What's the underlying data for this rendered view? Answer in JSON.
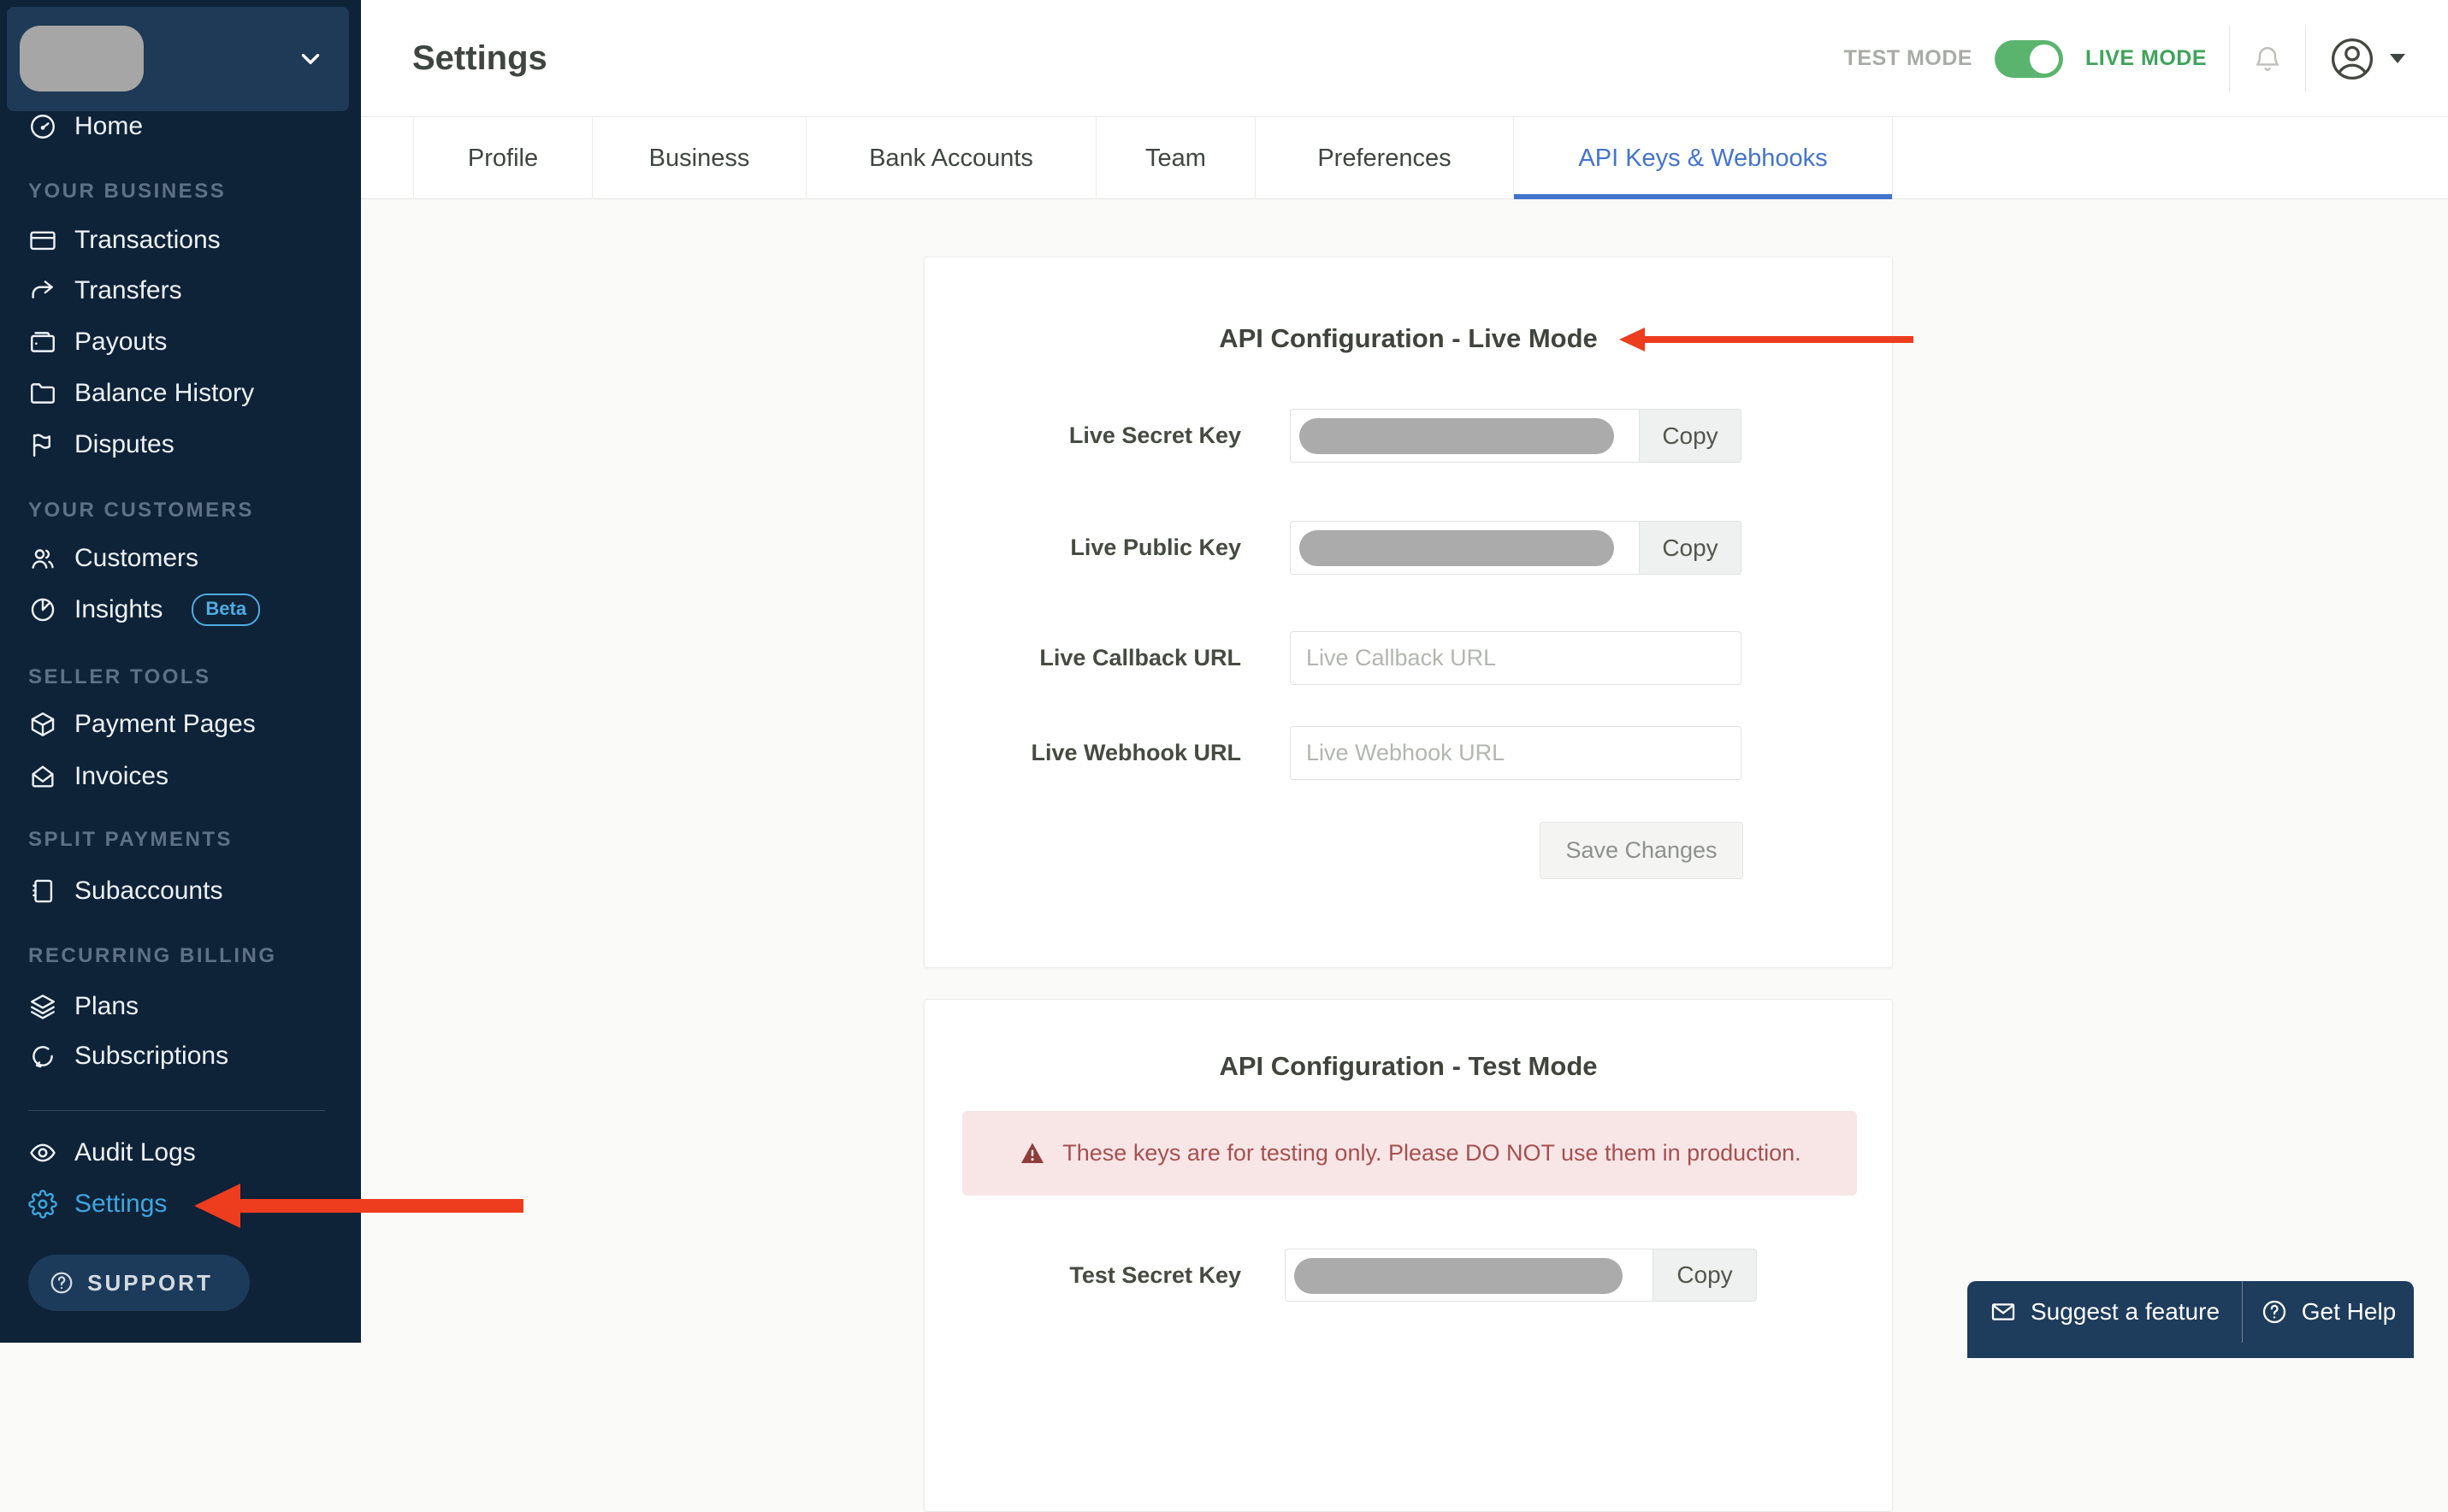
{
  "sidebar": {
    "nav": [
      {
        "label": "Home",
        "icon": "gauge-icon"
      }
    ],
    "sections": [
      {
        "title": "YOUR BUSINESS",
        "items": [
          {
            "label": "Transactions",
            "icon": "credit-card-icon"
          },
          {
            "label": "Transfers",
            "icon": "share-arrow-icon"
          },
          {
            "label": "Payouts",
            "icon": "wallet-icon"
          },
          {
            "label": "Balance History",
            "icon": "folder-icon"
          },
          {
            "label": "Disputes",
            "icon": "flag-icon"
          }
        ]
      },
      {
        "title": "YOUR CUSTOMERS",
        "items": [
          {
            "label": "Customers",
            "icon": "people-icon"
          },
          {
            "label": "Insights",
            "icon": "pie-chart-icon",
            "badge": "Beta"
          }
        ]
      },
      {
        "title": "SELLER TOOLS",
        "items": [
          {
            "label": "Payment Pages",
            "icon": "box-icon"
          },
          {
            "label": "Invoices",
            "icon": "envelope-open-icon"
          }
        ]
      },
      {
        "title": "SPLIT PAYMENTS",
        "items": [
          {
            "label": "Subaccounts",
            "icon": "notebook-icon"
          }
        ]
      },
      {
        "title": "RECURRING BILLING",
        "items": [
          {
            "label": "Plans",
            "icon": "layers-icon"
          },
          {
            "label": "Subscriptions",
            "icon": "loop-icon"
          }
        ]
      }
    ],
    "bottom_items": [
      {
        "label": "Audit Logs",
        "icon": "eye-icon",
        "active": false
      },
      {
        "label": "Settings",
        "icon": "gear-icon",
        "active": true
      }
    ],
    "support_label": "SUPPORT"
  },
  "header": {
    "title": "Settings",
    "test_mode_label": "TEST MODE",
    "live_mode_label": "LIVE MODE",
    "toggle_state": "on"
  },
  "tabs": [
    {
      "label": "Profile",
      "active": false
    },
    {
      "label": "Business",
      "active": false
    },
    {
      "label": "Bank Accounts",
      "active": false
    },
    {
      "label": "Team",
      "active": false
    },
    {
      "label": "Preferences",
      "active": false
    },
    {
      "label": "API Keys & Webhooks",
      "active": true
    }
  ],
  "live_card": {
    "title": "API Configuration - Live Mode",
    "secret_key_label": "Live Secret Key",
    "public_key_label": "Live Public Key",
    "callback_label": "Live Callback URL",
    "callback_placeholder": "Live Callback URL",
    "callback_value": "",
    "webhook_label": "Live Webhook URL",
    "webhook_placeholder": "Live Webhook URL",
    "webhook_value": "",
    "copy_label": "Copy",
    "save_label": "Save Changes"
  },
  "test_card": {
    "title": "API Configuration - Test Mode",
    "warning_text": "These keys are for testing only. Please DO NOT use them in production.",
    "secret_key_label": "Test Secret Key",
    "copy_label": "Copy"
  },
  "footer": {
    "suggest_label": "Suggest a feature",
    "help_label": "Get Help"
  },
  "colors": {
    "sidebar_bg": "#0E2238",
    "active_link_blue": "#3EA6DE",
    "tab_active_blue": "#4374CE",
    "toggle_green": "#5BB46E",
    "live_mode_green": "#3EA45A",
    "annotation_arrow_red": "#EE3C1F",
    "warning_bg": "#F8E6E7",
    "warning_text": "#A6504F",
    "redacted_key_grey": "#ABABAB"
  }
}
